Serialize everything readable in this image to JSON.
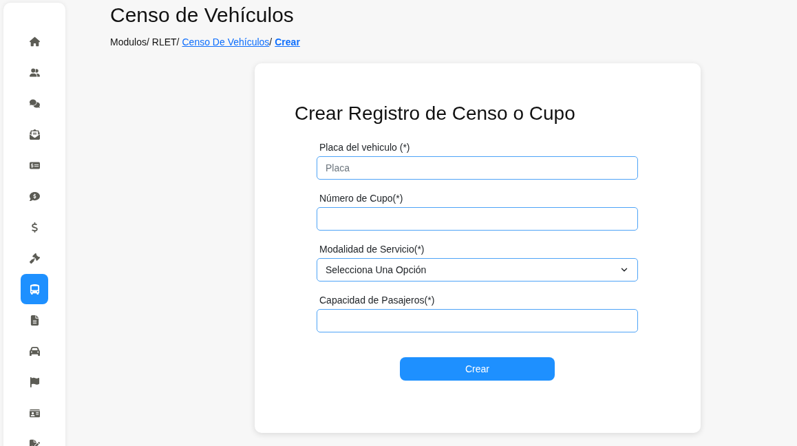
{
  "sidebar": {
    "items": [
      {
        "selected": false
      },
      {
        "selected": false
      },
      {
        "selected": false
      },
      {
        "selected": false
      },
      {
        "selected": false
      },
      {
        "selected": false
      },
      {
        "selected": false
      },
      {
        "selected": false
      },
      {
        "selected": true
      },
      {
        "selected": false
      },
      {
        "selected": false
      },
      {
        "selected": false
      },
      {
        "selected": false
      },
      {
        "selected": false
      }
    ]
  },
  "page_title": "Censo de Vehículos",
  "breadcrumb": {
    "separator": "/",
    "items": [
      {
        "label": "Modulos",
        "kind": "text"
      },
      {
        "label": "RLET",
        "kind": "text"
      },
      {
        "label": "Censo De Vehículos",
        "kind": "link"
      },
      {
        "label": "Crear",
        "kind": "current"
      }
    ]
  },
  "form": {
    "title": "Crear Registro de Censo o Cupo",
    "fields": [
      {
        "kind": "text",
        "label": "Placa del vehiculo (*)",
        "placeholder": "Placa"
      },
      {
        "kind": "text",
        "label": "Número de Cupo(*)"
      },
      {
        "kind": "select",
        "label": "Modalidad de Servicio(*)",
        "value": "Selecciona Una Opción"
      },
      {
        "kind": "text",
        "label": "Capacidad de Pasajeros(*)"
      }
    ],
    "submit_button": "Crear"
  }
}
